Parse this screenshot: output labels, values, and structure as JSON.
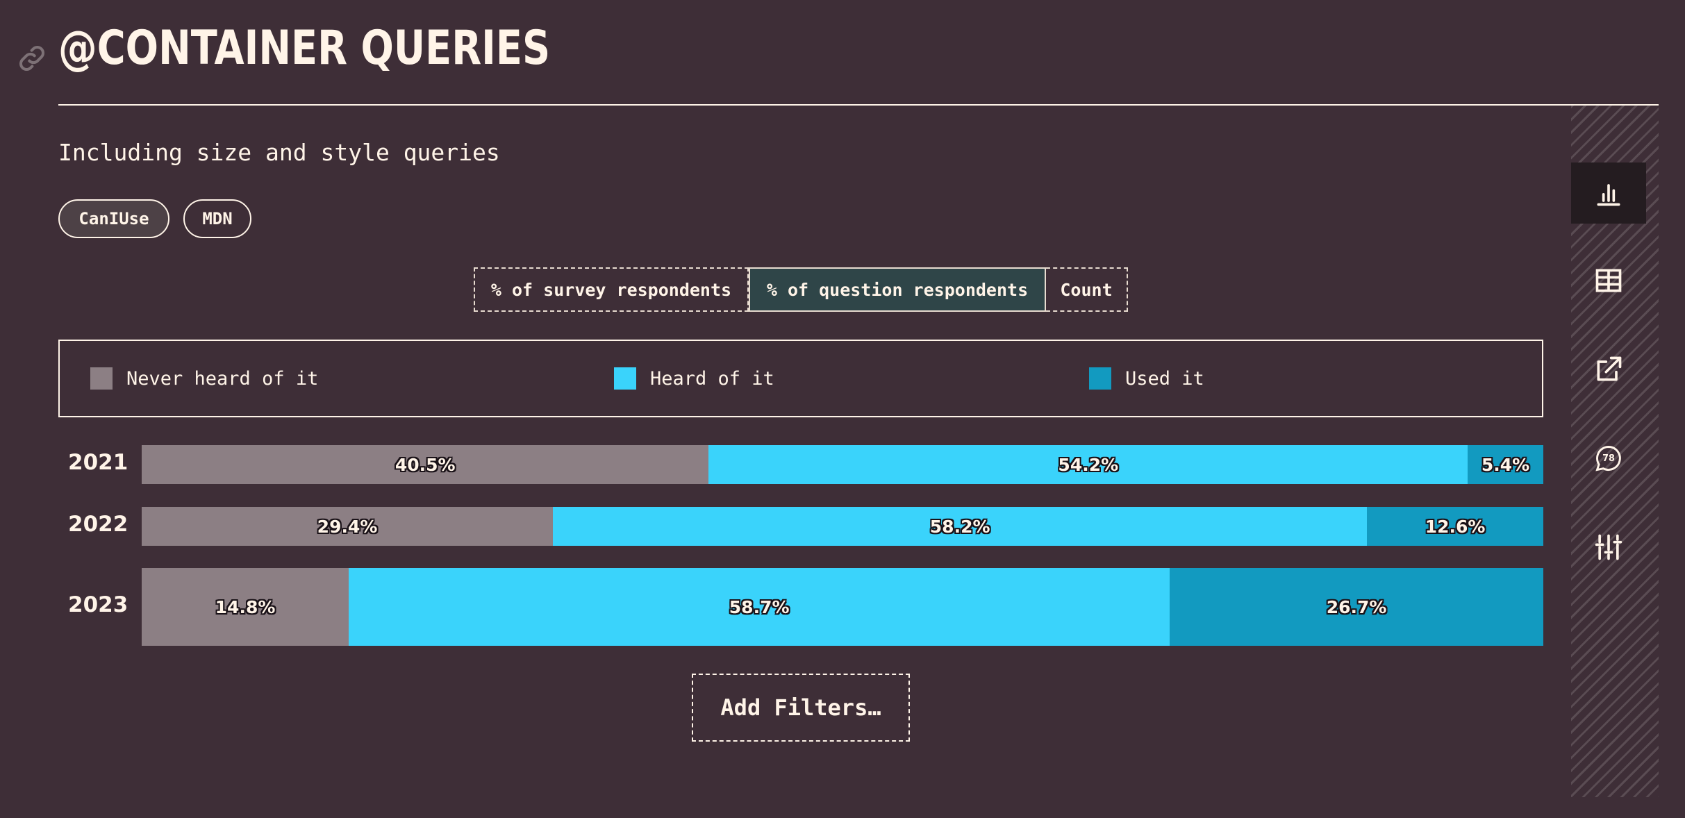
{
  "header": {
    "title": "@CONTAINER QUERIES",
    "subtitle": "Including size and style queries"
  },
  "links": [
    {
      "label": "CanIUse"
    },
    {
      "label": "MDN"
    }
  ],
  "units": {
    "options": [
      "% of survey respondents",
      "% of question respondents",
      "Count"
    ],
    "selected": "% of question respondents"
  },
  "legend": [
    {
      "label": "Never heard of it",
      "color": "#8c7f84"
    },
    {
      "label": "Heard of it",
      "color": "#3ad3fb"
    },
    {
      "label": "Used it",
      "color": "#129ac0"
    }
  ],
  "chart_data": {
    "type": "bar",
    "orientation": "horizontal",
    "stacked": true,
    "categories": [
      "2021",
      "2022",
      "2023"
    ],
    "series": [
      {
        "name": "Never heard of it",
        "values": [
          40.5,
          29.4,
          14.8
        ],
        "labels": [
          "40.5%",
          "29.4%",
          "14.8%"
        ]
      },
      {
        "name": "Heard of it",
        "values": [
          54.2,
          58.2,
          58.7
        ],
        "labels": [
          "54.2%",
          "58.2%",
          "58.7%"
        ]
      },
      {
        "name": "Used it",
        "values": [
          5.4,
          12.6,
          26.7
        ],
        "labels": [
          "5.4%",
          "12.6%",
          "26.7%"
        ]
      }
    ],
    "xlim": [
      0,
      100
    ],
    "legend_position": "top"
  },
  "actions": {
    "add_filters": "Add Filters…"
  },
  "sidebar": {
    "items": [
      {
        "icon": "bar-chart-icon",
        "active": true
      },
      {
        "icon": "table-icon"
      },
      {
        "icon": "share-icon"
      },
      {
        "icon": "comments-icon",
        "badge": "78"
      },
      {
        "icon": "sliders-icon"
      }
    ]
  }
}
